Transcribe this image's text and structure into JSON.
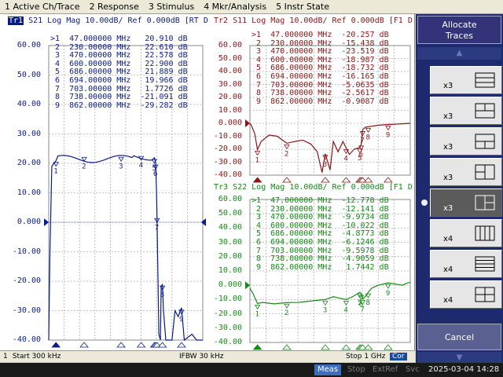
{
  "menu": [
    "1 Active Ch/Trace",
    "2 Response",
    "3 Stimulus",
    "4 Mkr/Analysis",
    "5 Instr State"
  ],
  "colors": {
    "tr1": "#0a1c8a",
    "tr2": "#8e1414",
    "tr3": "#138a13",
    "grid": "#9a9a9a"
  },
  "tr1": {
    "badge": "Tr1",
    "title": "S21  Log Mag 10.00dB/ Ref 0.000dB [RT D",
    "yticks": [
      "60.00",
      "50.00",
      "40.00",
      "30.00",
      "20.00",
      "10.00",
      "0.000",
      "-10.00",
      "-20.00",
      "-30.00",
      "-40.00"
    ],
    "markers": [
      {
        "n": ">1",
        "f": "47.000000 MHz",
        "v": "20.910 dB"
      },
      {
        "n": "2",
        "f": "230.00000 MHz",
        "v": "22.610 dB"
      },
      {
        "n": "3",
        "f": "470.00000 MHz",
        "v": "22.578 dB"
      },
      {
        "n": "4",
        "f": "600.00000 MHz",
        "v": "22.900 dB"
      },
      {
        "n": "5",
        "f": "686.00000 MHz",
        "v": "21.889 dB"
      },
      {
        "n": "6",
        "f": "694.00000 MHz",
        "v": "19.966 dB"
      },
      {
        "n": "7",
        "f": "703.00000 MHz",
        "v": "1.7726 dB"
      },
      {
        "n": "8",
        "f": "738.00000 MHz",
        "v": "-21.091 dB"
      },
      {
        "n": "9",
        "f": "862.00000 MHz",
        "v": "-29.282 dB"
      }
    ]
  },
  "tr2": {
    "title": "Tr2  S11  Log Mag 10.00dB/ Ref 0.000dB [F1 D",
    "yticks": [
      "60.00",
      "50.00",
      "40.00",
      "30.00",
      "20.00",
      "10.00",
      "0.000",
      "-10.00",
      "-20.00",
      "-30.00",
      "-40.00"
    ],
    "markers": [
      {
        "n": ">1",
        "f": "47.000000 MHz",
        "v": "-20.257 dB"
      },
      {
        "n": "2",
        "f": "230.00000 MHz",
        "v": "-15.438 dB"
      },
      {
        "n": "3",
        "f": "470.00000 MHz",
        "v": "-23.519 dB"
      },
      {
        "n": "4",
        "f": "600.00000 MHz",
        "v": "-18.987 dB"
      },
      {
        "n": "5",
        "f": "686.00000 MHz",
        "v": "-18.732 dB"
      },
      {
        "n": "6",
        "f": "694.00000 MHz",
        "v": "-16.165 dB"
      },
      {
        "n": "7",
        "f": "703.00000 MHz",
        "v": "-5.0635 dB"
      },
      {
        "n": "8",
        "f": "738.00000 MHz",
        "v": "-2.5617 dB"
      },
      {
        "n": "9",
        "f": "862.00000 MHz",
        "v": "-0.9087 dB"
      }
    ]
  },
  "tr3": {
    "title": "Tr3  S22  Log Mag 10.00dB/ Ref 0.000dB [F1 D",
    "yticks": [
      "60.00",
      "50.00",
      "40.00",
      "30.00",
      "20.00",
      "10.00",
      "0.000",
      "-10.00",
      "-20.00",
      "-30.00",
      "-40.00"
    ],
    "markers": [
      {
        "n": ">1",
        "f": "47.000000 MHz",
        "v": "-12.778 dB"
      },
      {
        "n": "2",
        "f": "230.00000 MHz",
        "v": "-12.141 dB"
      },
      {
        "n": "3",
        "f": "470.00000 MHz",
        "v": "-9.9734 dB"
      },
      {
        "n": "4",
        "f": "600.00000 MHz",
        "v": "-10.022 dB"
      },
      {
        "n": "5",
        "f": "686.00000 MHz",
        "v": "-4.8773 dB"
      },
      {
        "n": "6",
        "f": "694.00000 MHz",
        "v": "-6.1246 dB"
      },
      {
        "n": "7",
        "f": "703.00000 MHz",
        "v": "-9.5978 dB"
      },
      {
        "n": "8",
        "f": "738.00000 MHz",
        "v": "-4.9059 dB"
      },
      {
        "n": "9",
        "f": "862.00000 MHz",
        "v": "1.7442 dB"
      }
    ]
  },
  "sidebar": {
    "title": "Allocate\nTraces",
    "buttons": [
      {
        "label": "x3",
        "layout": "rows3"
      },
      {
        "label": "x3",
        "layout": "top2-bottom1"
      },
      {
        "label": "x3",
        "layout": "top1-bottom2"
      },
      {
        "label": "x3",
        "layout": "left2-right1"
      },
      {
        "label": "x3",
        "layout": "left1-right2",
        "selected": true
      },
      {
        "label": "x4",
        "layout": "cols4"
      },
      {
        "label": "x4",
        "layout": "rows4"
      },
      {
        "label": "x4",
        "layout": "grid2x2"
      }
    ],
    "cancel": "Cancel"
  },
  "status": {
    "channel": "1",
    "start": "Start 300 kHz",
    "ifbw": "IFBW 30 kHz",
    "stop": "Stop 1 GHz",
    "cor": "Cor",
    "meas": "Meas",
    "stop_btn": "Stop",
    "extref": "ExtRef",
    "svc": "Svc",
    "datetime": "2025-03-04 14:28"
  }
}
